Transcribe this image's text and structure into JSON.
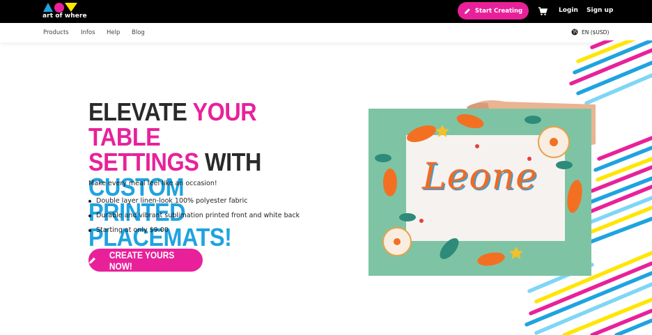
{
  "header": {
    "logo_text": "art of where",
    "start_label": "Start Creating",
    "login_label": "Login",
    "signup_label": "Sign up"
  },
  "nav": {
    "items": [
      "Products",
      "Infos",
      "Help",
      "Blog"
    ],
    "language": "EN ($USD)"
  },
  "hero": {
    "headline": [
      [
        {
          "text": "ELEVATE ",
          "color": "dark"
        },
        {
          "text": "YOUR TABLE",
          "color": "pink"
        }
      ],
      [
        {
          "text": "SETTINGS ",
          "color": "pink"
        },
        {
          "text": "WITH ",
          "color": "dark"
        },
        {
          "text": "CUSTOM",
          "color": "blue"
        }
      ],
      [
        {
          "text": "PRINTED PLACEMATS!",
          "color": "blue"
        }
      ]
    ],
    "subtitle": "Make every meal feel like an occasion!",
    "bullets": [
      "Double layer linen-look 100% polyester fabric",
      "Durable and vibrant sublimation printed front and white back",
      "Starting at only $9.00"
    ],
    "cta_label": "CREATE YOURS NOW!",
    "placemat_text": "Leone"
  },
  "colors": {
    "brand_pink": "#e8219a",
    "brand_blue": "#1fa3e0",
    "brand_yellow": "#ffe600",
    "placemat_green": "#7ec4a4"
  },
  "icons": [
    "logo-shapes",
    "pencil-icon",
    "cart-icon",
    "globe-icon"
  ]
}
